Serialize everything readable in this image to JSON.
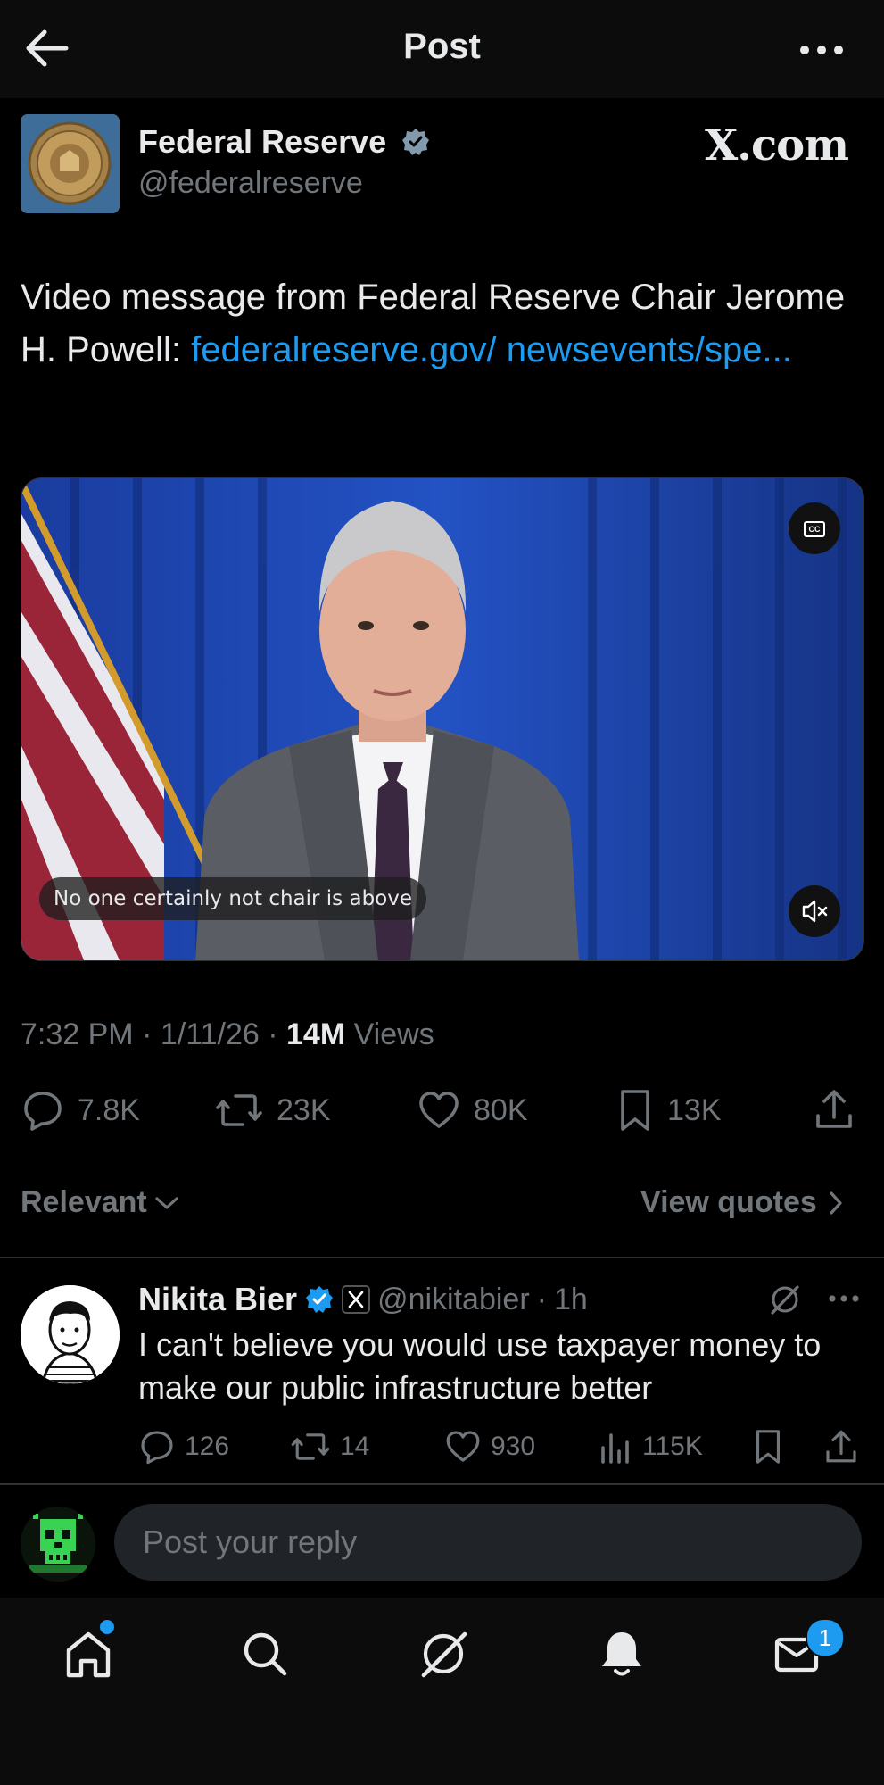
{
  "header": {
    "title": "Post"
  },
  "post": {
    "author_name": "Federal Reserve",
    "author_handle": "@federalreserve",
    "watermark": "X.com",
    "text_plain": "Video message from Federal Reserve Chair Jerome H. Powell: ",
    "link_text": "federalreserve.gov/ newsevents/spe...",
    "video_caption": "No one certainly not chair is above",
    "cc_label": "CC",
    "time": "7:32 PM",
    "date": "1/11/26",
    "views_count": "14M",
    "views_label": "Views",
    "separator": "·",
    "stats": {
      "replies": "7.8K",
      "reposts": "23K",
      "likes": "80K",
      "bookmarks": "13K"
    }
  },
  "filters": {
    "sort_label": "Relevant",
    "quotes_label": "View quotes"
  },
  "reply": {
    "name": "Nikita Bier",
    "handle": "@nikitabier",
    "time": "1h",
    "separator": "·",
    "text": "I can't believe you would use taxpayer money to make our public infrastructure better",
    "stats": {
      "replies": "126",
      "reposts": "14",
      "likes": "930",
      "views": "115K"
    }
  },
  "composer": {
    "placeholder": "Post your reply"
  },
  "nav": {
    "messages_badge": "1"
  },
  "colors": {
    "background": "#000000",
    "accent": "#1d9bf0",
    "muted": "#71767b",
    "text": "#e7e9ea"
  }
}
